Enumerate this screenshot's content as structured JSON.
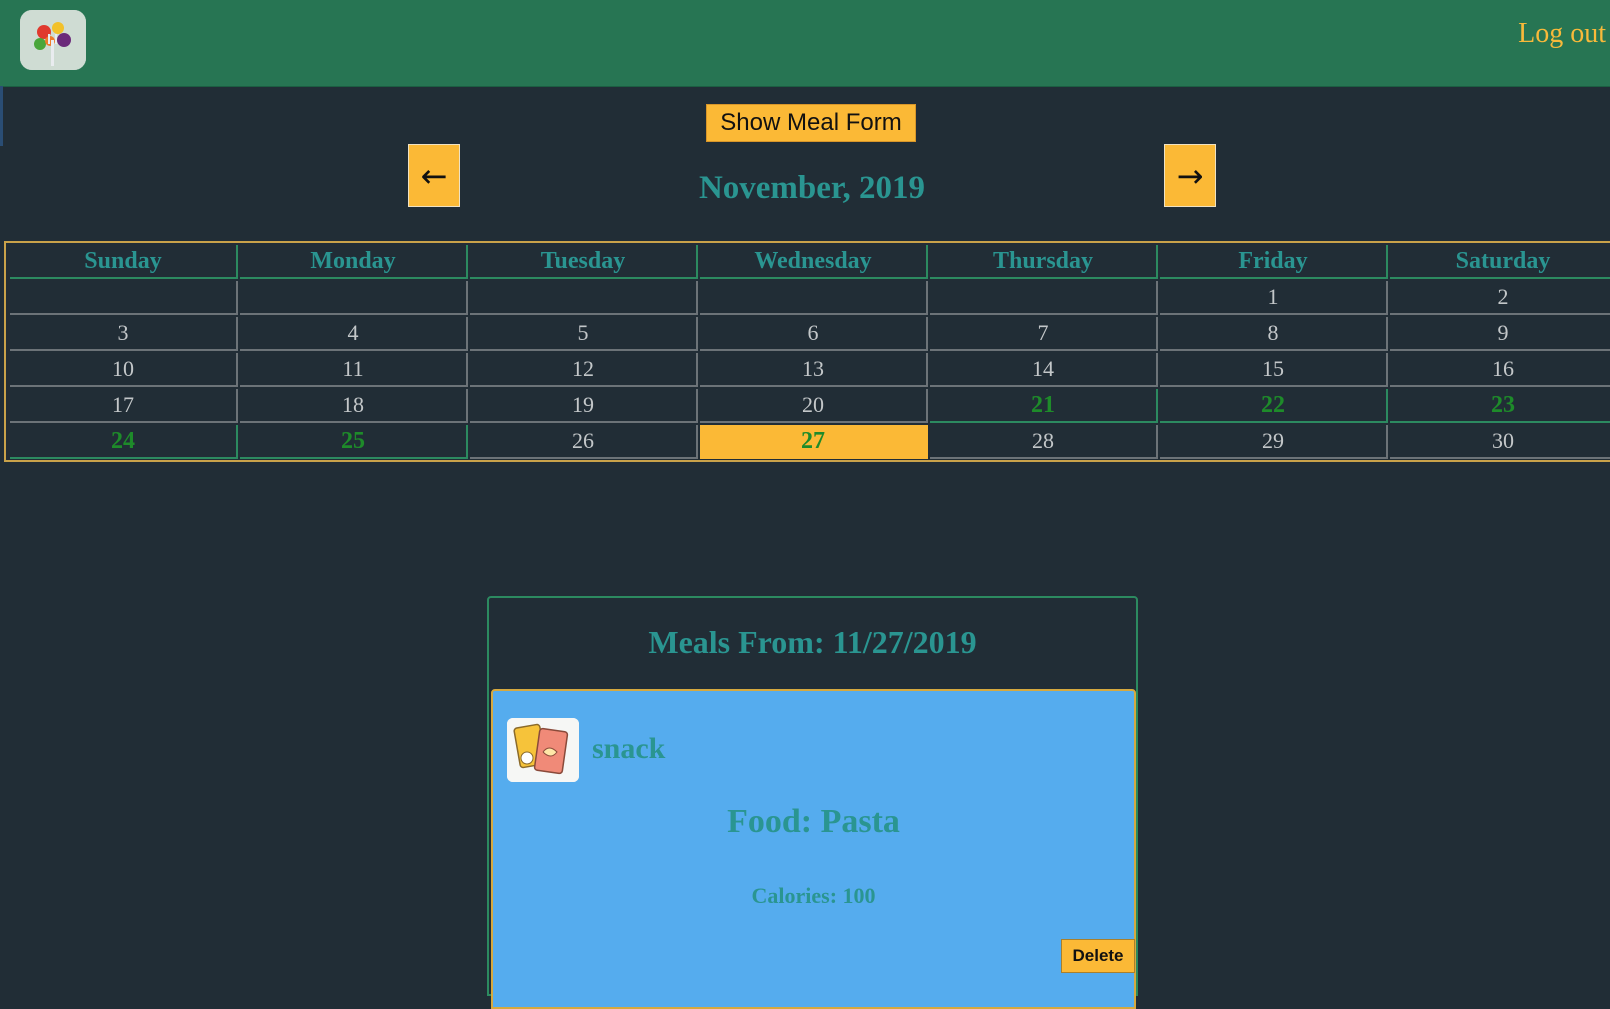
{
  "header": {
    "logo_icon": "fork-vegetables-logo-icon",
    "logout_label": "Log out"
  },
  "controls": {
    "show_form_label": "Show Meal Form",
    "prev_label": "←",
    "next_label": "→"
  },
  "calendar": {
    "month_title": "November, 2019",
    "weekdays": [
      "Sunday",
      "Monday",
      "Tuesday",
      "Wednesday",
      "Thursday",
      "Friday",
      "Saturday"
    ],
    "weeks": [
      [
        "",
        "",
        "",
        "",
        "",
        "1",
        "2"
      ],
      [
        "3",
        "4",
        "5",
        "6",
        "7",
        "8",
        "9"
      ],
      [
        "10",
        "11",
        "12",
        "13",
        "14",
        "15",
        "16"
      ],
      [
        "17",
        "18",
        "19",
        "20",
        "21",
        "22",
        "23"
      ],
      [
        "24",
        "25",
        "26",
        "27",
        "28",
        "29",
        "30"
      ]
    ],
    "days_with_meals": [
      "21",
      "22",
      "23",
      "24",
      "25"
    ],
    "selected_day": "27"
  },
  "meals": {
    "title": "Meals From: 11/27/2019",
    "items": [
      {
        "icon": "snack-bags-icon",
        "type": "snack",
        "food": "Food: Pasta",
        "calories": "Calories: 100",
        "delete_label": "Delete"
      }
    ]
  },
  "colors": {
    "header_bg": "#277553",
    "page_bg": "#212d36",
    "accent_yellow": "#fbb936",
    "teal_text": "#2a9591",
    "meal_day_green": "#1e8b2a",
    "card_blue": "#55acee"
  }
}
